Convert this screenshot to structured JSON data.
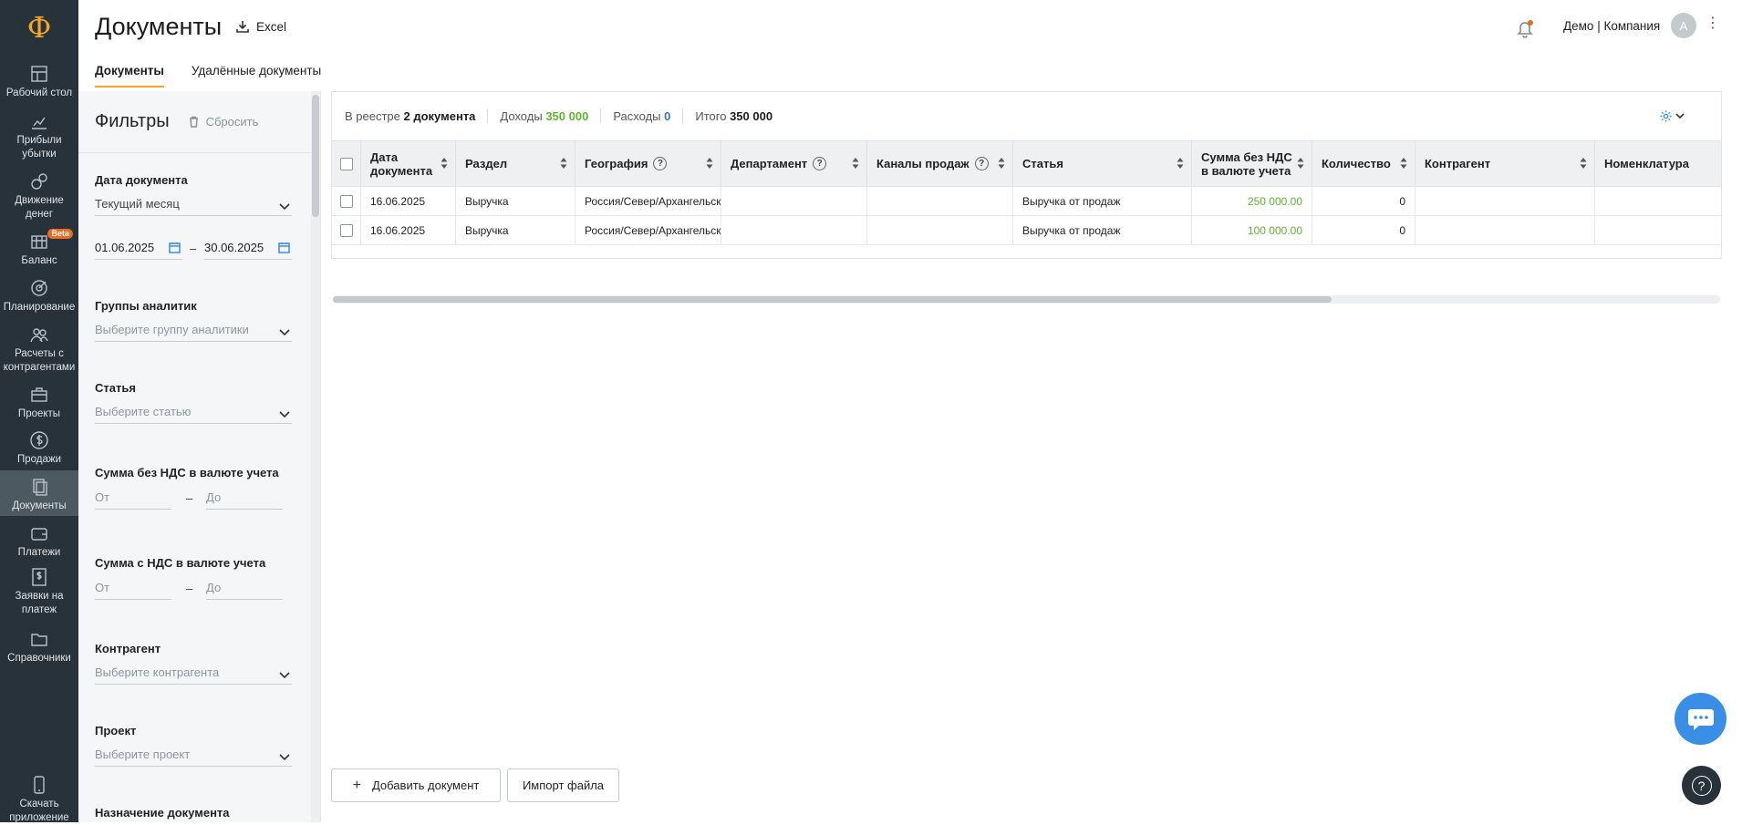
{
  "brand": {
    "logo": "Ф",
    "accent": "#f5a623",
    "nav_bg": "#27323a",
    "positive": "#5cb531"
  },
  "nav": {
    "items": [
      {
        "key": "dashboard",
        "icon": "dashboard-icon",
        "label": "Рабочий стол"
      },
      {
        "key": "pnl",
        "icon": "chart-icon",
        "label": "Прибыли убытки"
      },
      {
        "key": "cashflow",
        "icon": "money-flow-icon",
        "label": "Движение денег"
      },
      {
        "key": "balance",
        "icon": "balance-icon",
        "label": "Баланс",
        "badge": "Beta"
      },
      {
        "key": "planning",
        "icon": "target-icon",
        "label": "Планирование"
      },
      {
        "key": "counterparties",
        "icon": "users-icon",
        "label": "Расчеты с контрагентами"
      },
      {
        "key": "projects",
        "icon": "briefcase-icon",
        "label": "Проекты"
      },
      {
        "key": "sales",
        "icon": "dollar-icon",
        "label": "Продажи"
      },
      {
        "key": "documents",
        "icon": "documents-icon",
        "label": "Документы",
        "active": true
      },
      {
        "key": "payments",
        "icon": "wallet-icon",
        "label": "Платежи"
      },
      {
        "key": "requests",
        "icon": "payment-request-icon",
        "label": "Заявки на платеж"
      },
      {
        "key": "references",
        "icon": "folder-icon",
        "label": "Справочники"
      }
    ],
    "download_app": "Скачать приложение"
  },
  "header": {
    "title": "Документы",
    "excel_label": "Excel",
    "company": "Демо | Компания",
    "avatar_letter": "А"
  },
  "tabs": [
    {
      "label": "Документы",
      "active": true
    },
    {
      "label": "Удалённые документы",
      "active": false
    }
  ],
  "filters": {
    "title": "Фильтры",
    "reset": "Сбросить",
    "doc_date": {
      "label": "Дата документа",
      "value": "Текущий месяц",
      "from": "01.06.2025",
      "to": "30.06.2025"
    },
    "analytics": {
      "label": "Группы аналитик",
      "placeholder": "Выберите группу аналитики"
    },
    "article": {
      "label": "Статья",
      "placeholder": "Выберите статью"
    },
    "sum_no_vat": {
      "label": "Сумма без НДС в валюте учета",
      "from": "От",
      "to": "До"
    },
    "sum_vat": {
      "label": "Сумма с НДС в валюте учета",
      "from": "От",
      "to": "До"
    },
    "counterparty": {
      "label": "Контрагент",
      "placeholder": "Выберите контрагента"
    },
    "project": {
      "label": "Проект",
      "placeholder": "Выберите проект"
    },
    "purpose": {
      "label": "Назначение документа"
    }
  },
  "summary": {
    "registry_label": "В реестре",
    "registry_value": "2 документа",
    "income_label": "Доходы",
    "income_value": "350 000",
    "expense_label": "Расходы",
    "expense_value": "0",
    "total_label": "Итого",
    "total_value": "350 000"
  },
  "table": {
    "columns": [
      "Дата документа",
      "Раздел",
      "География",
      "Департамент",
      "Каналы продаж",
      "Статья",
      "Сумма без НДС в валюте учета",
      "Количество",
      "Контрагент",
      "Номенклатура"
    ],
    "rows": [
      [
        "16.06.2025",
        "Выручка",
        "Россия/Север/Архангельск",
        "",
        "",
        "Выручка от продаж",
        "250 000.00",
        "0",
        "",
        ""
      ],
      [
        "16.06.2025",
        "Выручка",
        "Россия/Север/Архангельск",
        "",
        "",
        "Выручка от продаж",
        "100 000.00",
        "0",
        "",
        ""
      ]
    ]
  },
  "actions": {
    "add_document": "Добавить документ",
    "import_file": "Импорт файла"
  }
}
